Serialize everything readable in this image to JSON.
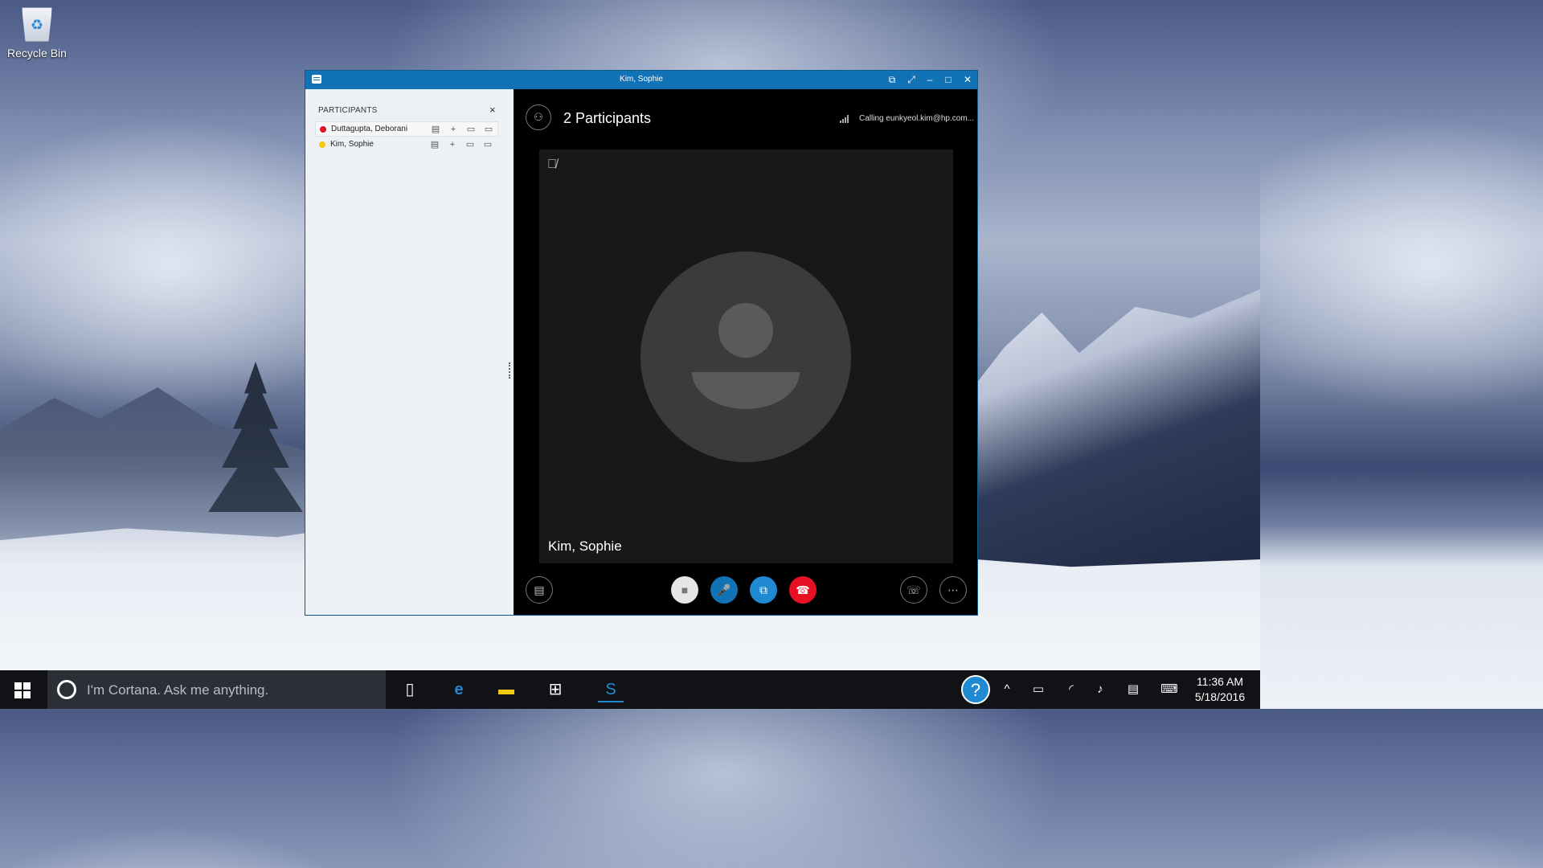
{
  "desktop": {
    "recycle_bin_label": "Recycle Bin",
    "recycle_icon": "recycle-bin-icon"
  },
  "window": {
    "title": "Kim, Sophie",
    "accent_color": "#1172b5",
    "titlebar_icons": [
      "chat-icon",
      "pop-out-icon",
      "full-screen-icon",
      "minimize-icon",
      "maximize-icon",
      "close-icon"
    ],
    "participants_pane": {
      "header": "PARTICIPANTS",
      "close_glyph": "×",
      "participants": [
        {
          "name": "Duttagupta, Deborani",
          "status_color": "#e81123",
          "status": "busy"
        },
        {
          "name": "Kim, Sophie",
          "status_color": "#f2c811",
          "status": "away"
        }
      ],
      "row_actions": [
        "im-icon",
        "add-icon",
        "video-icon",
        "screen-share-icon"
      ]
    },
    "stage": {
      "participant_count_label": "2 Participants",
      "calling_label": "Calling eunkyeol.kim@hp.com...",
      "video_name": "Kim, Sophie",
      "controls": [
        {
          "name": "im-icon",
          "style": "outline"
        },
        {
          "name": "video-icon",
          "style": "filled",
          "color": "#e6e6e6"
        },
        {
          "name": "microphone-icon",
          "style": "filled",
          "color": "#1172b5"
        },
        {
          "name": "present-icon",
          "style": "filled",
          "color": "#1f8ad2"
        },
        {
          "name": "hang-up-icon",
          "style": "filled",
          "color": "#e81123"
        },
        {
          "name": "call-controls-icon",
          "style": "outline"
        },
        {
          "name": "more-options-icon",
          "style": "outline"
        }
      ]
    }
  },
  "taskbar": {
    "cortana_placeholder": "I'm Cortana. Ask me anything.",
    "pinned": [
      "task-view-icon",
      "edge-icon",
      "file-explorer-icon",
      "store-icon",
      "skype-for-business-icon"
    ],
    "tray": [
      "help-icon",
      "show-hidden-icons-icon",
      "battery-icon",
      "wifi-icon",
      "volume-icon",
      "action-center-icon",
      "touch-keyboard-icon"
    ],
    "time": "11:36 AM",
    "date": "5/18/2016"
  }
}
